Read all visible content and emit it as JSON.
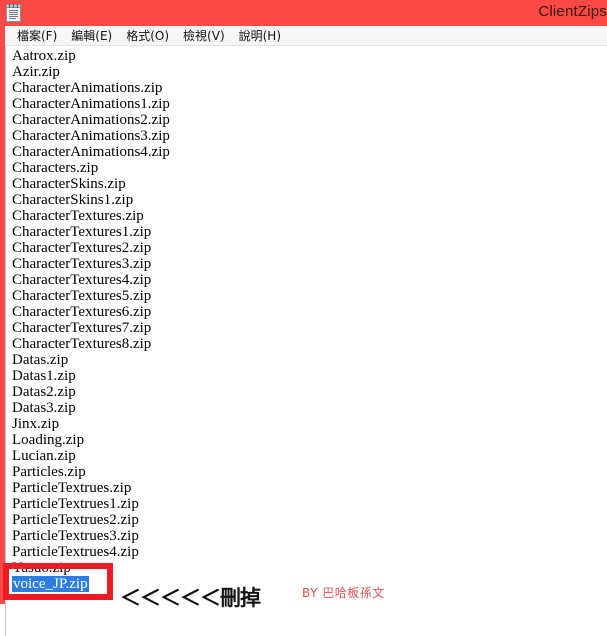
{
  "window": {
    "title": "ClientZips",
    "icon": "notepad-icon",
    "titlebar_color": "#fb4a46",
    "border_color": "#fb4a46"
  },
  "menubar": {
    "items": [
      {
        "label": "檔案(F)",
        "name": "menu-file"
      },
      {
        "label": "編輯(E)",
        "name": "menu-edit"
      },
      {
        "label": "格式(O)",
        "name": "menu-format"
      },
      {
        "label": "檢視(V)",
        "name": "menu-view"
      },
      {
        "label": "說明(H)",
        "name": "menu-help"
      }
    ]
  },
  "editor": {
    "lines": [
      "Aatrox.zip",
      "Azir.zip",
      "CharacterAnimations.zip",
      "CharacterAnimations1.zip",
      "CharacterAnimations2.zip",
      "CharacterAnimations3.zip",
      "CharacterAnimations4.zip",
      "Characters.zip",
      "CharacterSkins.zip",
      "CharacterSkins1.zip",
      "CharacterTextures.zip",
      "CharacterTextures1.zip",
      "CharacterTextures2.zip",
      "CharacterTextures3.zip",
      "CharacterTextures4.zip",
      "CharacterTextures5.zip",
      "CharacterTextures6.zip",
      "CharacterTextures7.zip",
      "CharacterTextures8.zip",
      "Datas.zip",
      "Datas1.zip",
      "Datas2.zip",
      "Datas3.zip",
      "Jinx.zip",
      "Loading.zip",
      "Lucian.zip",
      "Particles.zip",
      "ParticleTextrues.zip",
      "ParticleTextrues1.zip",
      "ParticleTextrues2.zip",
      "ParticleTextrues3.zip",
      "ParticleTextrues4.zip",
      "Yasuo.zip"
    ],
    "selected_line": "voice_JP.zip",
    "selection_bg": "#2b7de0",
    "selection_fg": "#ffffff"
  },
  "annotations": {
    "delete_label": "＜＜＜＜＜刪掉",
    "credit": "BY 巴哈板孫文",
    "box_color": "#ed1c24",
    "credit_color": "#e0514f"
  }
}
